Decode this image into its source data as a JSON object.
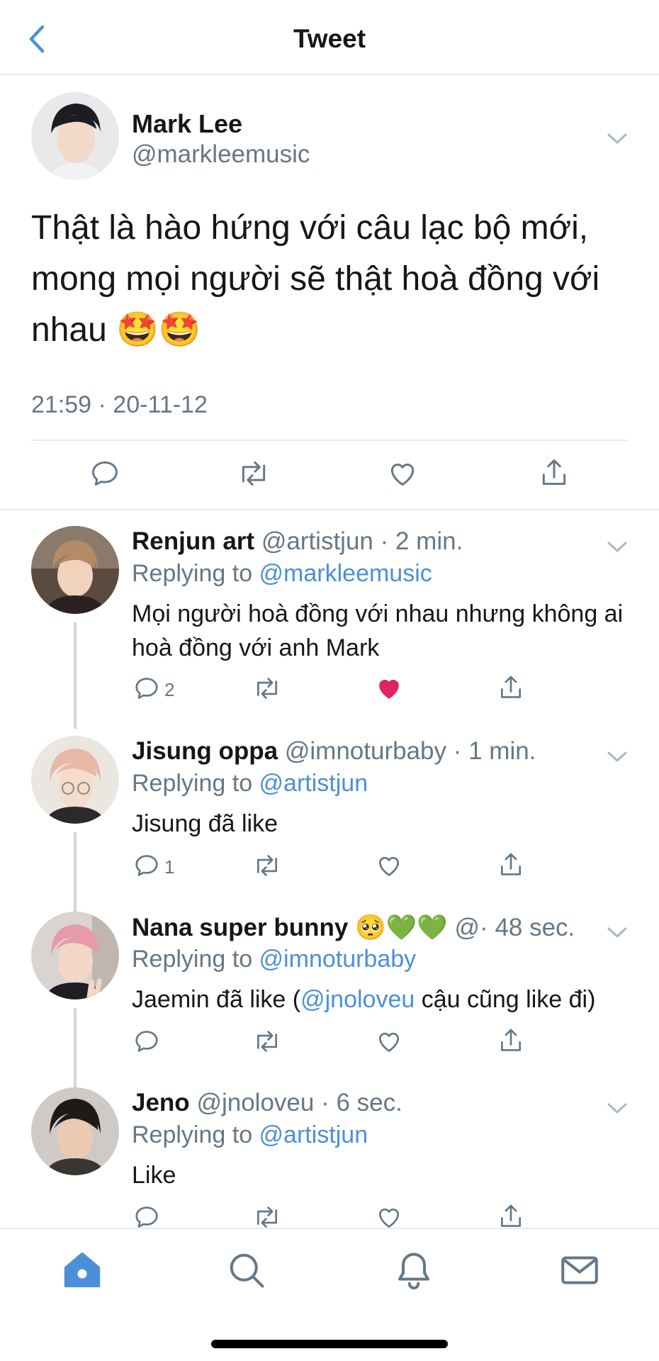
{
  "header": {
    "title": "Tweet"
  },
  "main_tweet": {
    "name": "Mark Lee",
    "handle": "@markleemusic",
    "text": "Thật là hào hứng với câu lạc bộ mới, mong mọi người sẽ thật hoà đồng với nhau 🤩🤩",
    "timestamp": "21:59 · 20-11-12"
  },
  "replies": [
    {
      "name": "Renjun art",
      "meta": "@artistjun · 2 min.",
      "replying_prefix": "Replying to ",
      "replying_to": "@markleemusic",
      "text": "Mọi người hoà đồng với nhau nhưng không ai hoà đồng với anh Mark",
      "reply_count": "2",
      "liked": true
    },
    {
      "name": "Jisung oppa",
      "meta": "@imnoturbaby · 1 min.",
      "replying_prefix": "Replying to ",
      "replying_to": "@artistjun",
      "text": "Jisung đã like",
      "reply_count": "1",
      "liked": false
    },
    {
      "name": "Nana super bunny 🥺💚💚",
      "meta": "@· 48 sec.",
      "replying_prefix": "Replying to ",
      "replying_to": "@imnoturbaby",
      "text_before": "Jaemin đã like (",
      "text_mention": "@jnoloveu",
      "text_after": " cậu cũng like đi)",
      "reply_count": "",
      "liked": false
    },
    {
      "name": "Jeno",
      "meta": "@jnoloveu · 6 sec.",
      "replying_prefix": "Replying to ",
      "replying_to": "@artistjun",
      "text": "Like",
      "reply_count": "",
      "liked": false
    }
  ],
  "colors": {
    "accent": "#4a90d9",
    "like": "#e0245e",
    "muted": "#657786"
  },
  "tabbar": [
    "home-icon",
    "search-icon",
    "notifications-icon",
    "messages-icon"
  ]
}
